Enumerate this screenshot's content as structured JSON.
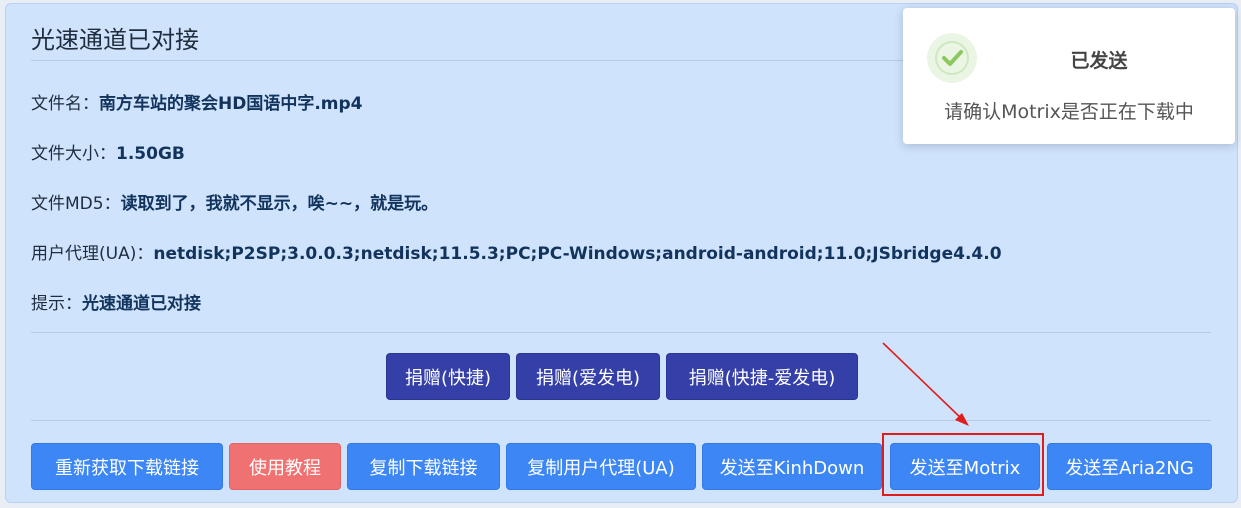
{
  "header": {
    "title": "光速通道已对接"
  },
  "info": {
    "filename_label": "文件名：",
    "filename_value": "南方车站的聚会HD国语中字.mp4",
    "size_label": "文件大小：",
    "size_value": "1.50GB",
    "md5_label": "文件MD5：",
    "md5_value": "读取到了，我就不显示，唉~~，就是玩。",
    "ua_label": "用户代理(UA)：",
    "ua_value": "netdisk;P2SP;3.0.0.3;netdisk;11.5.3;PC;PC-Windows;android-android;11.0;JSbridge4.4.0",
    "tip_label": "提示：",
    "tip_value": "光速通道已对接"
  },
  "donate": {
    "quick": "捐赠(快捷)",
    "aifadian": "捐赠(爱发电)",
    "quick_aifadian": "捐赠(快捷-爱发电)"
  },
  "actions": {
    "refetch": "重新获取下载链接",
    "tutorial": "使用教程",
    "copy_link": "复制下载链接",
    "copy_ua": "复制用户代理(UA)",
    "send_kinhdown": "发送至KinhDown",
    "send_motrix": "发送至Motrix",
    "send_aria2ng": "发送至Aria2NG"
  },
  "toast": {
    "title": "已发送",
    "message": "请确认Motrix是否正在下载中",
    "icon": "check-icon",
    "icon_color": "#8cc860"
  },
  "colors": {
    "panel": "#cfe3fd",
    "primary": "#3d86f5",
    "dark": "#353fa8",
    "danger": "#f07171",
    "highlight": "#e01d1d"
  }
}
